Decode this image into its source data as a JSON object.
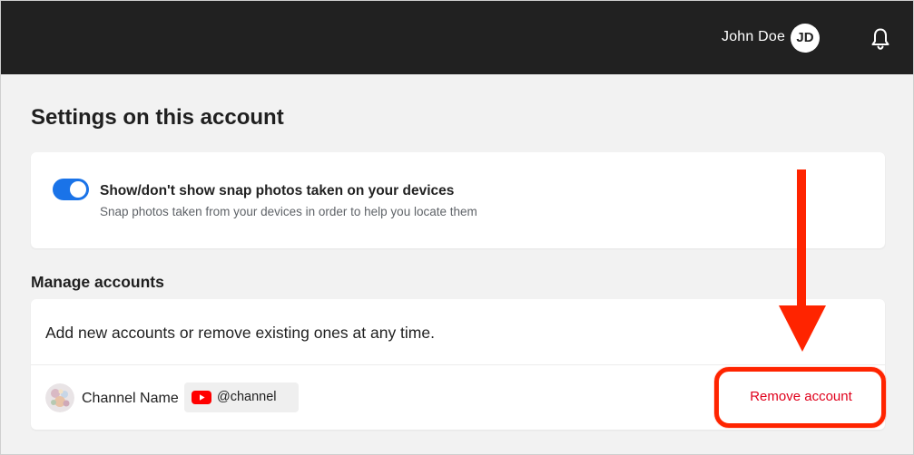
{
  "header": {
    "user_name": "John Doe",
    "user_initials": "JD",
    "notifications_icon": "bell-icon"
  },
  "page": {
    "title": "Settings on this account"
  },
  "snap_setting": {
    "toggle_on": true,
    "title": "Show/don't show snap photos taken on your devices",
    "subtitle": "Snap photos taken from your devices in order to help you locate them"
  },
  "manage_accounts": {
    "section_title": "Manage accounts",
    "description": "Add new accounts or remove existing ones at any time.",
    "accounts": [
      {
        "name": "Channel Name",
        "handle": "@channel",
        "platform_icon": "youtube-icon",
        "remove_label": "Remove account"
      }
    ]
  },
  "colors": {
    "topbar": "#212121",
    "toggle_on": "#1a73e8",
    "remove_text": "#e0001b",
    "annotation": "#ff2400"
  }
}
